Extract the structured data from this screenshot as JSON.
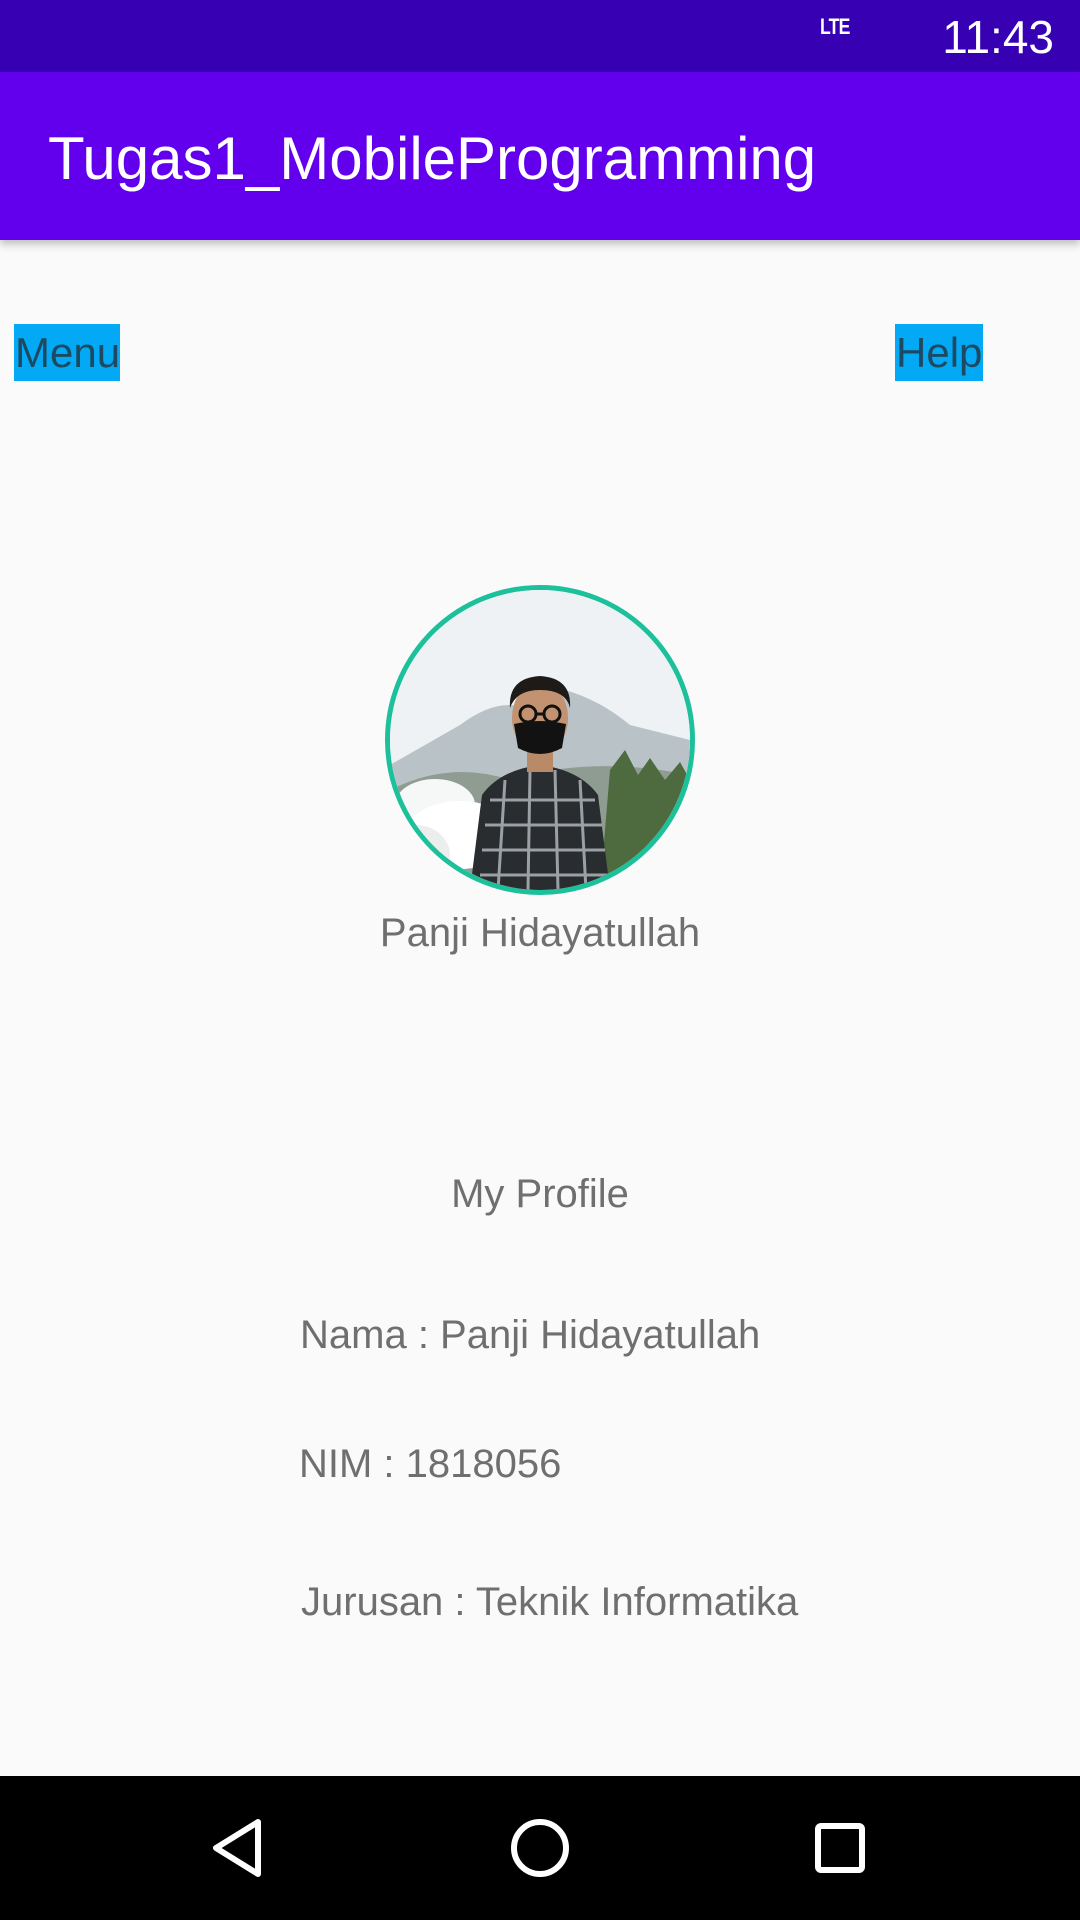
{
  "status_bar": {
    "network": "LTE",
    "time": "11:43",
    "background": "#3700b3"
  },
  "app_bar": {
    "title": "Tugas1_MobileProgramming",
    "background": "#6200ee"
  },
  "buttons": {
    "menu_label": "Menu",
    "help_label": "Help",
    "highlight_color": "#03a9f4"
  },
  "profile": {
    "avatar_icon": "profile-photo",
    "avatar_border_color": "#1cc09a",
    "name": "Panji Hidayatullah",
    "heading": "My Profile",
    "nama_line": "Nama : Panji Hidayatullah",
    "nim_line": "NIM : 1818056",
    "jurusan_line": "Jurusan : Teknik Informatika"
  },
  "navigation": {
    "back_icon": "back-triangle",
    "home_icon": "home-circle",
    "recents_icon": "recents-square"
  }
}
